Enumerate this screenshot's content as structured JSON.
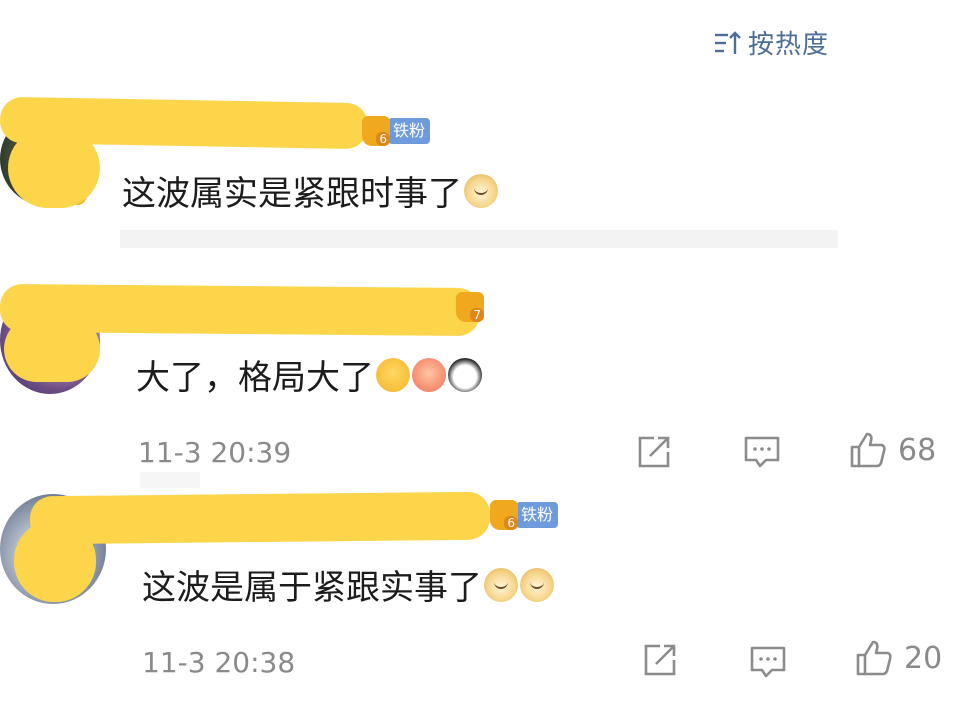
{
  "sort": {
    "label": "按热度"
  },
  "comments": [
    {
      "text": "这波属实是紧跟时事了",
      "badge": {
        "level": "6",
        "fan_label": "铁粉"
      },
      "emojis": [
        "doge"
      ]
    },
    {
      "text": "大了，格局大了",
      "badge": {
        "level": "7"
      },
      "emojis": [
        "laugh-cry",
        "hug",
        "husky"
      ],
      "time": "11-3 20:39",
      "likes": "68"
    },
    {
      "text": "这波是属于紧跟实事了",
      "badge": {
        "level": "6",
        "fan_label": "铁粉"
      },
      "emojis": [
        "doge",
        "doge"
      ],
      "time": "11-3 20:38",
      "likes": "20"
    }
  ],
  "colors": {
    "accent": "#4c6e96",
    "fan_badge": "#6d9bdc",
    "redaction": "#fcd54a"
  }
}
